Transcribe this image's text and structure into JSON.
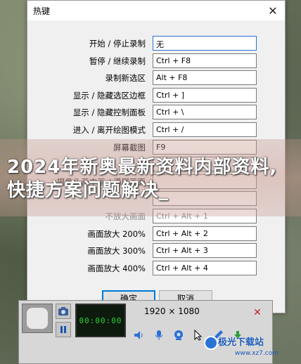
{
  "dialog": {
    "title": "热键",
    "close_symbol": "✕",
    "rows": [
      {
        "label": "开始 / 停止录制",
        "value": "无",
        "disabled": false,
        "active": true
      },
      {
        "label": "暂停 / 继续录制",
        "value": "Ctrl + F8",
        "disabled": false
      },
      {
        "label": "录制新选区",
        "value": "Alt + F8",
        "disabled": false
      },
      {
        "label": "显示 / 隐藏选区边框",
        "value": "Ctrl + ]",
        "disabled": false
      },
      {
        "label": "显示 / 隐藏控制面板",
        "value": "Ctrl + \\",
        "disabled": false
      },
      {
        "label": "进入 / 离开绘图模式",
        "value": "Ctrl + /",
        "disabled": false
      },
      {
        "label": "屏幕截图",
        "value": "F9",
        "disabled": false
      },
      {
        "label": "",
        "value": "",
        "disabled": false
      },
      {
        "label": "摄像头画中画 / 满屏画面",
        "value": "",
        "disabled": false
      },
      {
        "label": "",
        "value": "",
        "disabled": true
      },
      {
        "label": "不放大画面",
        "value": "Ctrl + Alt + 1",
        "disabled": true
      },
      {
        "label": "画面放大 200%",
        "value": "Ctrl + Alt + 2",
        "disabled": false
      },
      {
        "label": "画面放大 300%",
        "value": "Ctrl + Alt + 3",
        "disabled": false
      },
      {
        "label": "画面放大 400%",
        "value": "Ctrl + Alt + 4",
        "disabled": false
      }
    ],
    "ok_label": "确定",
    "cancel_label": "取消"
  },
  "overlay": {
    "headline": "2024年新奥最新资料内部资料,快捷方案问题解决_"
  },
  "toolbar": {
    "resolution": "1920 × 1080",
    "timer": "00:00:00",
    "icons": [
      "camera-icon",
      "pause-icon",
      "speaker-icon",
      "microphone-icon",
      "webcam-icon",
      "cursor-icon",
      "pen-icon",
      "download-icon",
      "close-icon"
    ]
  },
  "watermark": {
    "text": "极光下载站",
    "sub": "www.xz7.com"
  }
}
